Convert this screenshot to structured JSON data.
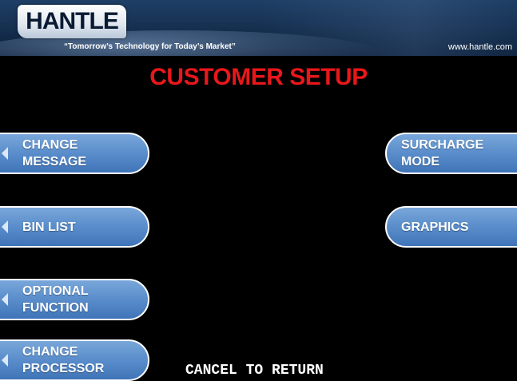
{
  "header": {
    "logo_text": "HANTLE",
    "slogan": "“Tomorrow’s Technology for Today’s Market”",
    "website": "www.hantle.com"
  },
  "title": "CUSTOMER SETUP",
  "left_buttons": [
    {
      "label": "CHANGE\nMESSAGE"
    },
    {
      "label": "BIN LIST"
    },
    {
      "label": "OPTIONAL\nFUNCTION"
    },
    {
      "label": "CHANGE\nPROCESSOR"
    }
  ],
  "right_buttons": [
    {
      "label": "SURCHARGE\nMODE"
    },
    {
      "label": "GRAPHICS"
    }
  ],
  "footer": {
    "instruction": "CANCEL TO RETURN"
  },
  "colors": {
    "title_red": "#e8171b",
    "button_blue": "#5c8fcc",
    "background": "#000000"
  }
}
